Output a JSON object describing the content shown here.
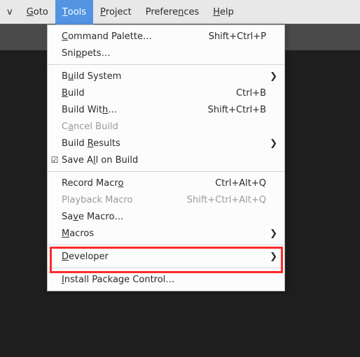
{
  "menubar": {
    "items": [
      {
        "before": "",
        "ul": "",
        "after": "v",
        "active": false,
        "name": "menubar-item-view-partial"
      },
      {
        "before": "",
        "ul": "G",
        "after": "oto",
        "active": false,
        "name": "menubar-item-goto"
      },
      {
        "before": "",
        "ul": "T",
        "after": "ools",
        "active": true,
        "name": "menubar-item-tools"
      },
      {
        "before": "",
        "ul": "P",
        "after": "roject",
        "active": false,
        "name": "menubar-item-project"
      },
      {
        "before": "Prefere",
        "ul": "n",
        "after": "ces",
        "active": false,
        "name": "menubar-item-preferences"
      },
      {
        "before": "",
        "ul": "H",
        "after": "elp",
        "active": false,
        "name": "menubar-item-help"
      }
    ]
  },
  "menu": {
    "items": [
      {
        "type": "item",
        "before": "",
        "ul": "C",
        "after": "ommand Palette…",
        "shortcut": "Shift+Ctrl+P",
        "sub": false,
        "disabled": false,
        "checked": false,
        "name": "menu-command-palette"
      },
      {
        "type": "item",
        "before": "Sni",
        "ul": "p",
        "after": "pets…",
        "shortcut": "",
        "sub": false,
        "disabled": false,
        "checked": false,
        "name": "menu-snippets"
      },
      {
        "type": "sep"
      },
      {
        "type": "item",
        "before": "B",
        "ul": "u",
        "after": "ild System",
        "shortcut": "",
        "sub": true,
        "disabled": false,
        "checked": false,
        "name": "menu-build-system"
      },
      {
        "type": "item",
        "before": "",
        "ul": "B",
        "after": "uild",
        "shortcut": "Ctrl+B",
        "sub": false,
        "disabled": false,
        "checked": false,
        "name": "menu-build"
      },
      {
        "type": "item",
        "before": "Build Wit",
        "ul": "h",
        "after": "…",
        "shortcut": "Shift+Ctrl+B",
        "sub": false,
        "disabled": false,
        "checked": false,
        "name": "menu-build-with"
      },
      {
        "type": "item",
        "before": "C",
        "ul": "a",
        "after": "ncel Build",
        "shortcut": "",
        "sub": false,
        "disabled": true,
        "checked": false,
        "name": "menu-cancel-build"
      },
      {
        "type": "item",
        "before": "Build ",
        "ul": "R",
        "after": "esults",
        "shortcut": "",
        "sub": true,
        "disabled": false,
        "checked": false,
        "name": "menu-build-results"
      },
      {
        "type": "item",
        "before": "Save A",
        "ul": "l",
        "after": "l on Build",
        "shortcut": "",
        "sub": false,
        "disabled": false,
        "checked": true,
        "name": "menu-save-all-on-build"
      },
      {
        "type": "sep"
      },
      {
        "type": "item",
        "before": "Record Macr",
        "ul": "o",
        "after": "",
        "shortcut": "Ctrl+Alt+Q",
        "sub": false,
        "disabled": false,
        "checked": false,
        "name": "menu-record-macro"
      },
      {
        "type": "item",
        "before": "Playback Macro",
        "ul": "",
        "after": "",
        "shortcut": "Shift+Ctrl+Alt+Q",
        "sub": false,
        "disabled": true,
        "checked": false,
        "name": "menu-playback-macro"
      },
      {
        "type": "item",
        "before": "Sa",
        "ul": "v",
        "after": "e Macro…",
        "shortcut": "",
        "sub": false,
        "disabled": false,
        "checked": false,
        "name": "menu-save-macro"
      },
      {
        "type": "item",
        "before": "",
        "ul": "M",
        "after": "acros",
        "shortcut": "",
        "sub": true,
        "disabled": false,
        "checked": false,
        "name": "menu-macros"
      },
      {
        "type": "sep"
      },
      {
        "type": "item",
        "before": "",
        "ul": "D",
        "after": "eveloper",
        "shortcut": "",
        "sub": true,
        "disabled": false,
        "checked": false,
        "name": "menu-developer"
      },
      {
        "type": "sep"
      },
      {
        "type": "item",
        "before": "",
        "ul": "I",
        "after": "nstall Package Control…",
        "shortcut": "",
        "sub": false,
        "disabled": false,
        "checked": false,
        "name": "menu-install-package-control"
      }
    ]
  },
  "glyphs": {
    "submenu": "❯",
    "check": "☑"
  }
}
